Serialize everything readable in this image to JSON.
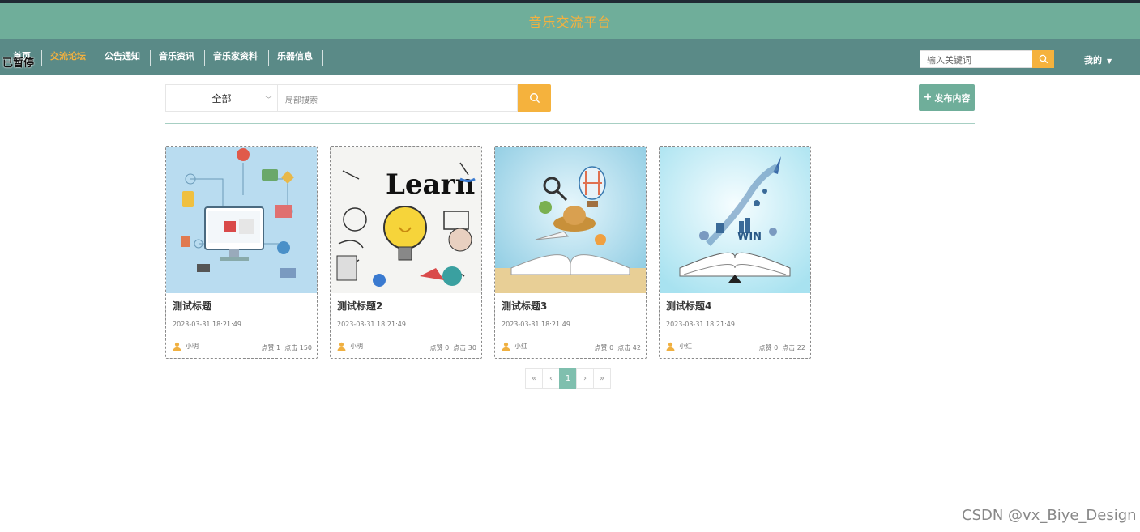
{
  "app": {
    "title": "音乐交流平台"
  },
  "nav": {
    "items": [
      {
        "label": "首页",
        "active": false
      },
      {
        "label": "交流论坛",
        "active": true
      },
      {
        "label": "公告通知",
        "active": false
      },
      {
        "label": "音乐资讯",
        "active": false
      },
      {
        "label": "音乐家资料",
        "active": false
      },
      {
        "label": "乐器信息",
        "active": false
      }
    ],
    "overlay": "已暂停",
    "search_placeholder": "输入关键词",
    "me_label": "我的",
    "active_color": "#f4b13e"
  },
  "filter": {
    "category_selected": "全部",
    "search_placeholder": "局部搜索",
    "publish_label": "发布内容"
  },
  "posts": [
    {
      "title": "测试标题",
      "date": "2023-03-31 18:21:49",
      "author": "小明",
      "likes": "点赞 1",
      "clicks": "点击 150",
      "image": "tech-icons"
    },
    {
      "title": "测试标题2",
      "date": "2023-03-31 18:21:49",
      "author": "小明",
      "likes": "点赞 0",
      "clicks": "点击 30",
      "image": "learn-lightbulb"
    },
    {
      "title": "测试标题3",
      "date": "2023-03-31 18:21:49",
      "author": "小红",
      "likes": "点赞 0",
      "clicks": "点击 42",
      "image": "open-book-travel"
    },
    {
      "title": "测试标题4",
      "date": "2023-03-31 18:21:49",
      "author": "小红",
      "likes": "点赞 0",
      "clicks": "点击 22",
      "image": "open-book-rocket"
    }
  ],
  "pagination": {
    "first": "«",
    "prev": "‹",
    "current": "1",
    "next": "›",
    "last": "»"
  },
  "watermark": "CSDN @vx_Biye_Design",
  "colors": {
    "header": "#6fae9a",
    "navbar": "#5a8a87",
    "accent": "#f5b23d"
  }
}
